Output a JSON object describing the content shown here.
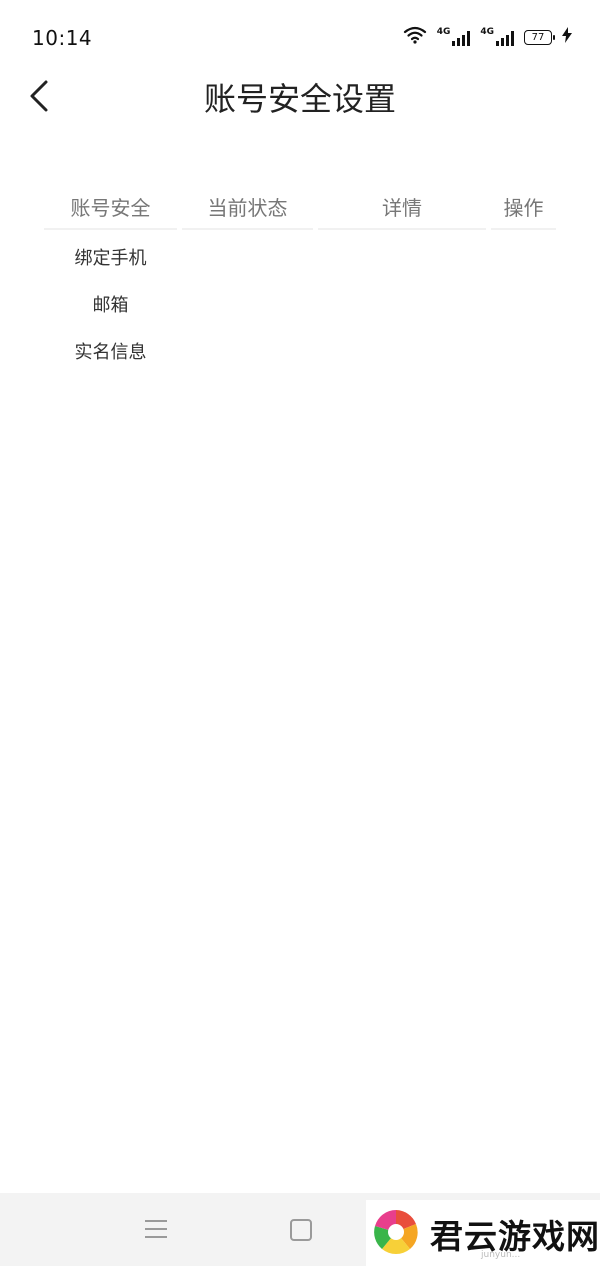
{
  "status_bar": {
    "time": "10:14",
    "network_1": "4G",
    "network_2": "4G",
    "battery_level": "77"
  },
  "header": {
    "title": "账号安全设置",
    "back_icon": "chevron-left-icon"
  },
  "table": {
    "columns": [
      "账号安全",
      "当前状态",
      "详情",
      "操作"
    ],
    "rows": [
      {
        "item": "绑定手机",
        "status": "",
        "detail": "",
        "action": ""
      },
      {
        "item": "邮箱",
        "status": "",
        "detail": "",
        "action": ""
      },
      {
        "item": "实名信息",
        "status": "",
        "detail": "",
        "action": ""
      }
    ]
  },
  "nav_bar": {
    "menu_icon": "menu-icon",
    "home_icon": "home-square-icon"
  },
  "watermark": {
    "text": "君云游戏网",
    "subtext": "junyun..."
  },
  "colors": {
    "background": "#ffffff",
    "header_text": "#777777",
    "body_text": "#333333",
    "nav_bar_bg": "#f3f3f3"
  }
}
